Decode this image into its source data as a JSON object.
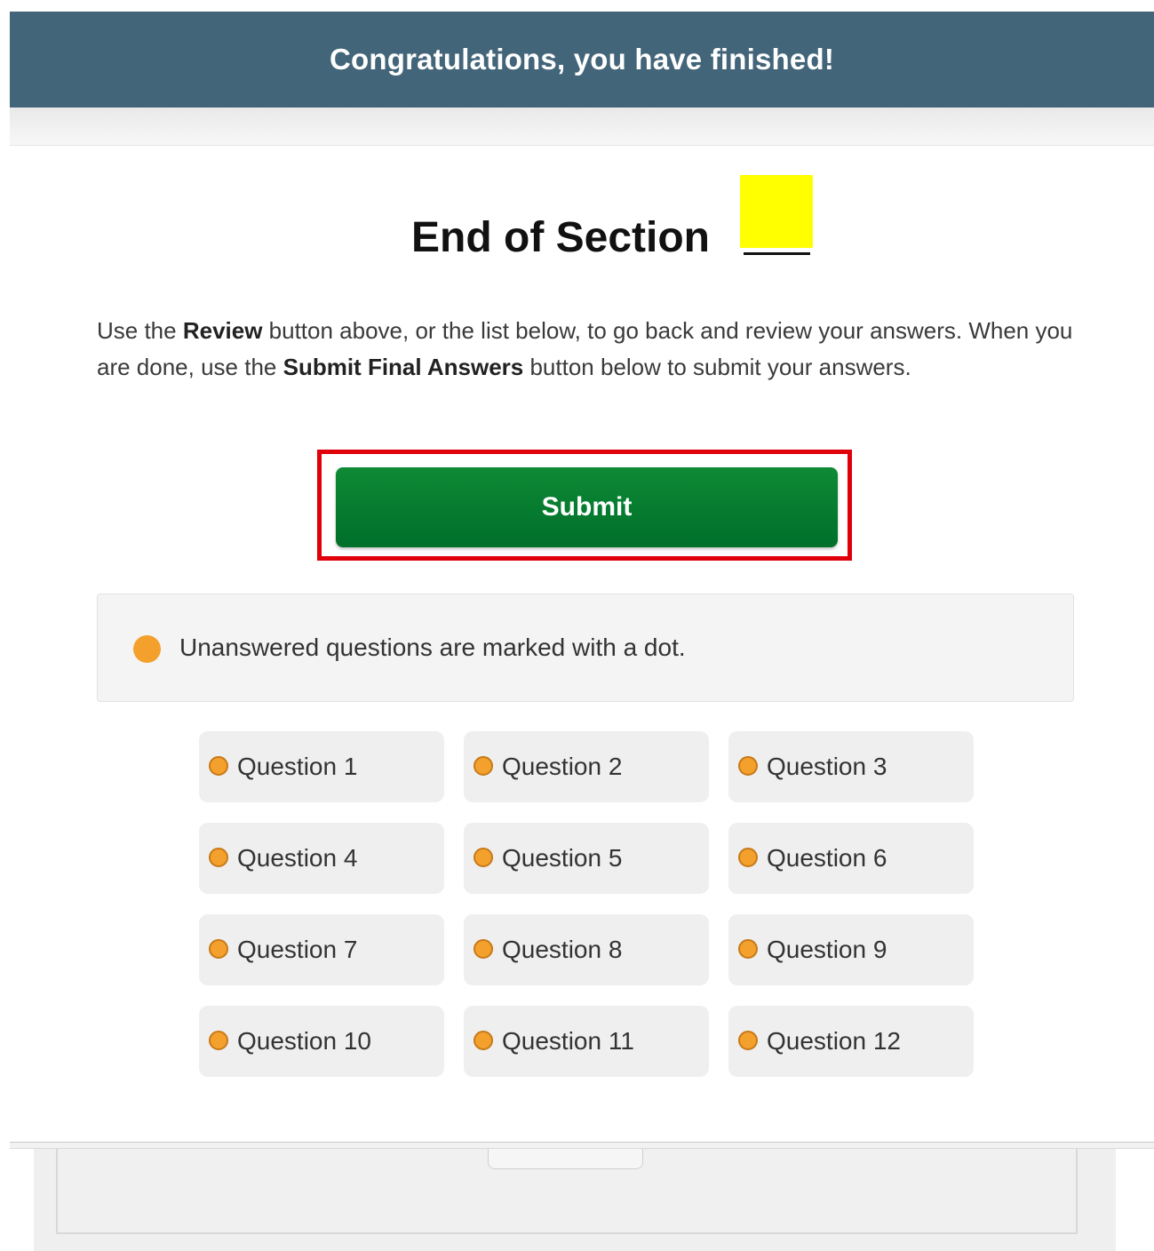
{
  "header": {
    "title": "Congratulations, you have finished!",
    "color": "#436579"
  },
  "section": {
    "title": "End of Section",
    "blank_highlight_color": "#ffff00"
  },
  "instructions": {
    "part1": "Use the ",
    "bold1": "Review",
    "part2": " button above, or the list below, to go back and review your answers. When you are done, use the ",
    "bold2": "Submit Final Answers",
    "part3": " button below to submit your answers."
  },
  "submit": {
    "label": "Submit",
    "color": "#0e8a35",
    "highlight_border_color": "#e0000a"
  },
  "legend": {
    "text": "Unanswered questions are marked with a dot.",
    "dot_color": "#f3a02d",
    "icon": "unanswered-dot-icon"
  },
  "questions": [
    {
      "label": "Question 1",
      "answered": false
    },
    {
      "label": "Question 2",
      "answered": false
    },
    {
      "label": "Question 3",
      "answered": false
    },
    {
      "label": "Question 4",
      "answered": false
    },
    {
      "label": "Question 5",
      "answered": false
    },
    {
      "label": "Question 6",
      "answered": false
    },
    {
      "label": "Question 7",
      "answered": false
    },
    {
      "label": "Question 8",
      "answered": false
    },
    {
      "label": "Question 9",
      "answered": false
    },
    {
      "label": "Question 10",
      "answered": false
    },
    {
      "label": "Question 11",
      "answered": false
    },
    {
      "label": "Question 12",
      "answered": false
    }
  ]
}
